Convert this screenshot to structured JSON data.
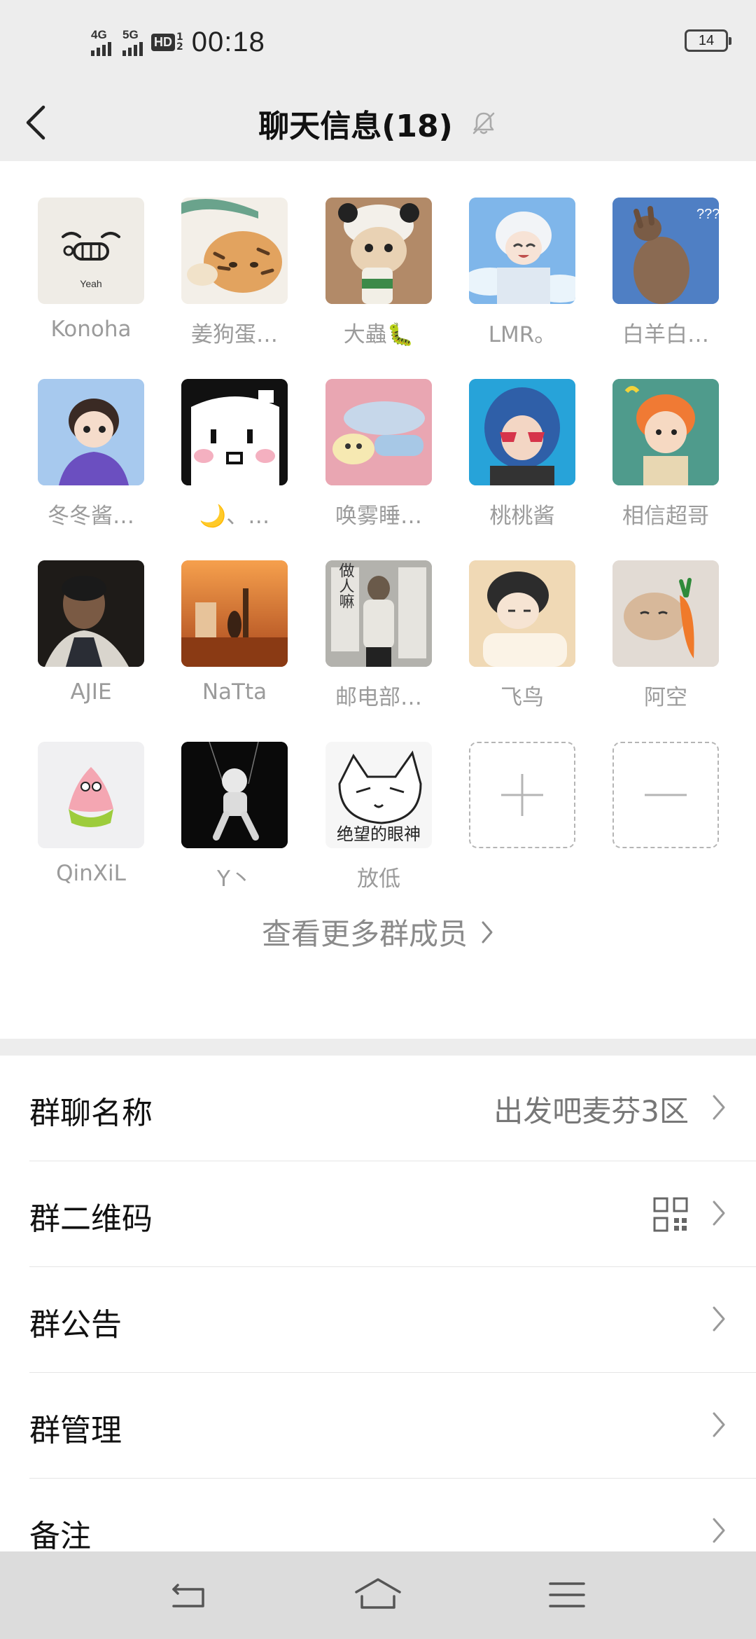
{
  "status": {
    "net1": "4G",
    "net2": "5G",
    "hd": "HD",
    "hd_sub1": "1",
    "hd_sub2": "2",
    "time": "00:18",
    "battery": "14"
  },
  "header": {
    "title": "聊天信息(18)"
  },
  "members": [
    {
      "name": "Konoha",
      "bg": "#efece6"
    },
    {
      "name": "姜狗蛋…",
      "bg": "#e9c79a"
    },
    {
      "name": "大蟲🐛",
      "bg": "#b89070"
    },
    {
      "name": "LMR。",
      "bg": "#8cbde8"
    },
    {
      "name": "白羊白…",
      "bg": "#4e80c6"
    },
    {
      "name": "冬冬酱…",
      "bg": "#7f8fd0"
    },
    {
      "name": "🌙、…",
      "bg": "#111111"
    },
    {
      "name": "唤雾睡…",
      "bg": "#eaa3b0"
    },
    {
      "name": "桃桃酱",
      "bg": "#2fa6d6"
    },
    {
      "name": "相信超哥",
      "bg": "#4d9c8c"
    },
    {
      "name": "AJIE",
      "bg": "#2b2622"
    },
    {
      "name": "NaTta",
      "bg": "#d8702c"
    },
    {
      "name": "邮电部…",
      "bg": "#9a9a96"
    },
    {
      "name": "飞鸟",
      "bg": "#e6c59a"
    },
    {
      "name": "阿空",
      "bg": "#d9d2cb"
    },
    {
      "name": "QinXiL",
      "bg": "#eeeeee"
    },
    {
      "name": "Y丶",
      "bg": "#0c0c0c"
    },
    {
      "name": "放低",
      "bg": "#f4f4f4"
    }
  ],
  "avatar_texts": {
    "konoha": "Yeah",
    "fangdi": "绝望的眼神",
    "youdian": "做人嘛"
  },
  "more_members": "查看更多群成员",
  "settings": {
    "group_name_label": "群聊名称",
    "group_name_value": "出发吧麦芬3区",
    "qr_label": "群二维码",
    "notice_label": "群公告",
    "manage_label": "群管理",
    "remark_label": "备注"
  },
  "colors": {
    "accent_text": "#111111",
    "secondary_text": "#9b9b9b",
    "background": "#ededed"
  }
}
